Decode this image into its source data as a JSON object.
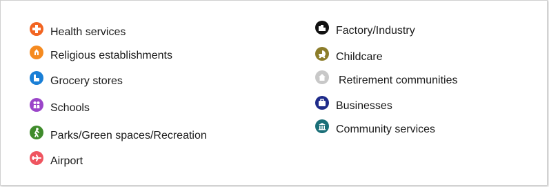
{
  "legend": {
    "items": [
      {
        "label": "Health services",
        "icon": "health-cross-icon",
        "color": "#f26522"
      },
      {
        "label": "Religious establishments",
        "icon": "religious-icon",
        "color": "#f58a1f"
      },
      {
        "label": "Grocery stores",
        "icon": "grocery-icon",
        "color": "#1a7fd6"
      },
      {
        "label": "Schools",
        "icon": "school-icon",
        "color": "#9b45c9"
      },
      {
        "label": "Parks/Green spaces/Recreation",
        "icon": "park-icon",
        "color": "#3f8b2b"
      },
      {
        "label": "Airport",
        "icon": "airport-icon",
        "color": "#ef5560"
      },
      {
        "label": "Factory/Industry",
        "icon": "factory-icon",
        "color": "#111111"
      },
      {
        "label": "Childcare",
        "icon": "childcare-icon",
        "color": "#8c7d2a"
      },
      {
        "label": "Retirement communities",
        "icon": "retirement-icon",
        "color": "#c8c8c8"
      },
      {
        "label": "Businesses",
        "icon": "business-icon",
        "color": "#1e2b8a"
      },
      {
        "label": "Community services",
        "icon": "community-icon",
        "color": "#1a6f78"
      }
    ]
  }
}
